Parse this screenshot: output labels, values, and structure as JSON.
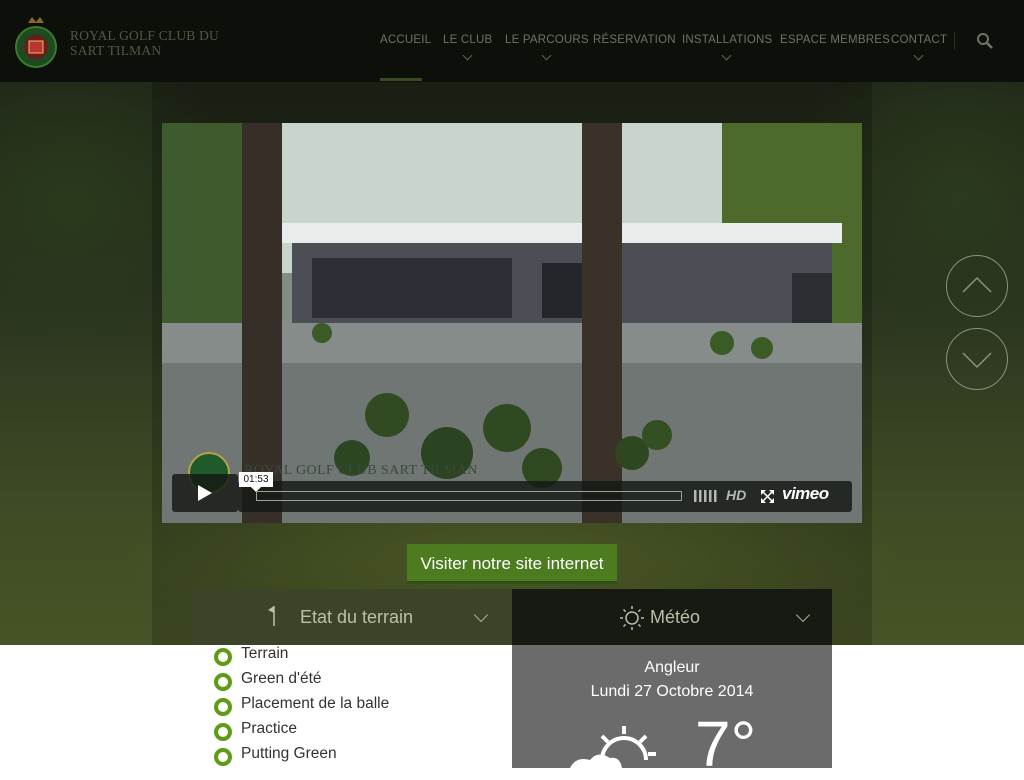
{
  "header": {
    "brand_line1": "ROYAL GOLF CLUB DU",
    "brand_line2": "SART TILMAN",
    "menu": [
      {
        "label": "ACCUEIL",
        "active": true,
        "submenu": false
      },
      {
        "label": "LE CLUB",
        "active": false,
        "submenu": true
      },
      {
        "label": "LE PARCOURS",
        "active": false,
        "submenu": true
      },
      {
        "label": "RÉSERVATION",
        "active": false,
        "submenu": false
      },
      {
        "label": "INSTALLATIONS",
        "active": false,
        "submenu": true
      },
      {
        "label": "ESPACE MEMBRES",
        "active": false,
        "submenu": false
      },
      {
        "label": "CONTACT",
        "active": false,
        "submenu": true
      }
    ],
    "search_icon": "search-icon"
  },
  "video": {
    "overlay_title": "ROYAL GOLF CLUB SART TILMAN",
    "current_time": "01:53",
    "hd_label": "HD",
    "provider": "vimeo",
    "progress": 0.0
  },
  "cta": {
    "site_button": "Visiter notre site internet"
  },
  "tabs": {
    "terrain": {
      "label": "Etat du terrain",
      "icon": "flag-icon"
    },
    "meteo": {
      "label": "Météo",
      "icon": "sun-icon"
    }
  },
  "terrain": {
    "items": [
      "Terrain",
      "Green d'été",
      "Placement de la balle",
      "Practice",
      "Putting Green"
    ]
  },
  "weather": {
    "location": "Angleur",
    "date": "Lundi 27 Octobre 2014",
    "temperature": "7°",
    "icon": "partly-cloudy-icon"
  },
  "colors": {
    "accent_green": "#4d7b1f",
    "dot_green": "#5e9c15",
    "nav_bg": "#0c0f0a",
    "weather_bg": "#6b6b6b"
  }
}
